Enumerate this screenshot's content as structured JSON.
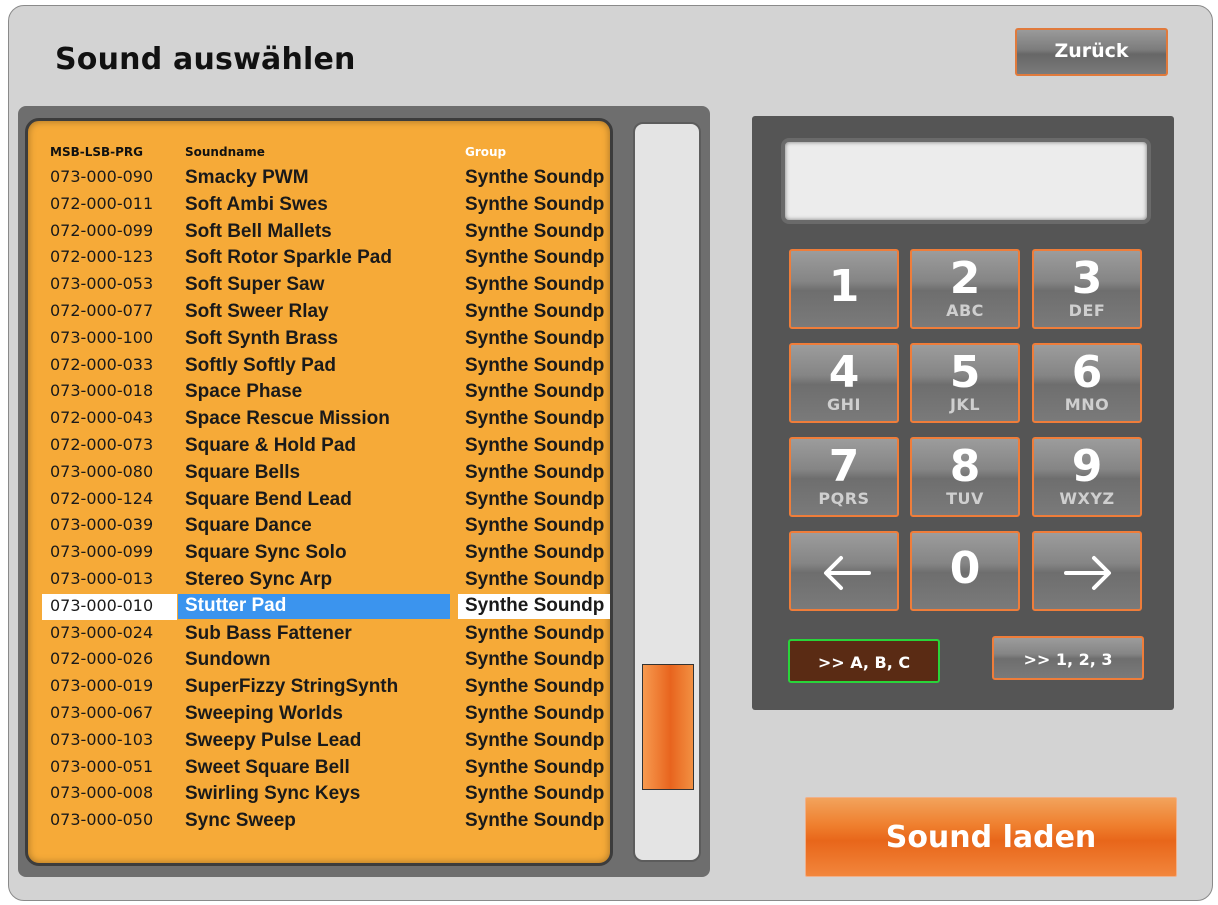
{
  "window": {
    "title": "Sound auswählen",
    "back_label": "Zurück",
    "load_label": "Sound laden"
  },
  "list": {
    "headers": {
      "msb": "MSB-LSB-PRG",
      "name": "Soundname",
      "group": "Group"
    },
    "selected_index": 16,
    "rows": [
      {
        "id": "073-000-090",
        "name": "Smacky PWM",
        "group": "Synthe Soundp"
      },
      {
        "id": "072-000-011",
        "name": "Soft Ambi Swes",
        "group": "Synthe Soundp"
      },
      {
        "id": "072-000-099",
        "name": "Soft Bell Mallets",
        "group": "Synthe Soundp"
      },
      {
        "id": "072-000-123",
        "name": "Soft Rotor Sparkle Pad",
        "group": "Synthe Soundp"
      },
      {
        "id": "073-000-053",
        "name": "Soft Super Saw",
        "group": "Synthe Soundp"
      },
      {
        "id": "072-000-077",
        "name": "Soft Sweer Rlay",
        "group": "Synthe Soundp"
      },
      {
        "id": "073-000-100",
        "name": "Soft Synth Brass",
        "group": "Synthe Soundp"
      },
      {
        "id": "072-000-033",
        "name": "Softly Softly Pad",
        "group": "Synthe Soundp"
      },
      {
        "id": "073-000-018",
        "name": "Space Phase",
        "group": "Synthe Soundp"
      },
      {
        "id": "072-000-043",
        "name": "Space Rescue Mission",
        "group": "Synthe Soundp"
      },
      {
        "id": "072-000-073",
        "name": "Square & Hold Pad",
        "group": "Synthe Soundp"
      },
      {
        "id": "073-000-080",
        "name": "Square Bells",
        "group": "Synthe Soundp"
      },
      {
        "id": "072-000-124",
        "name": "Square Bend Lead",
        "group": "Synthe Soundp"
      },
      {
        "id": "073-000-039",
        "name": "Square Dance",
        "group": "Synthe Soundp"
      },
      {
        "id": "073-000-099",
        "name": "Square Sync Solo",
        "group": "Synthe Soundp"
      },
      {
        "id": "073-000-013",
        "name": "Stereo Sync Arp",
        "group": "Synthe Soundp"
      },
      {
        "id": "073-000-010",
        "name": "Stutter Pad",
        "group": "Synthe Soundp"
      },
      {
        "id": "073-000-024",
        "name": "Sub Bass Fattener",
        "group": "Synthe Soundp"
      },
      {
        "id": "072-000-026",
        "name": "Sundown",
        "group": "Synthe Soundp"
      },
      {
        "id": "073-000-019",
        "name": "SuperFizzy StringSynth",
        "group": "Synthe Soundp"
      },
      {
        "id": "073-000-067",
        "name": "Sweeping Worlds",
        "group": "Synthe Soundp"
      },
      {
        "id": "073-000-103",
        "name": "Sweepy Pulse Lead",
        "group": "Synthe Soundp"
      },
      {
        "id": "073-000-051",
        "name": "Sweet Square Bell",
        "group": "Synthe Soundp"
      },
      {
        "id": "073-000-008",
        "name": "Swirling Sync Keys",
        "group": "Synthe Soundp"
      },
      {
        "id": "073-000-050",
        "name": "Sync Sweep",
        "group": "Synthe Soundp"
      }
    ]
  },
  "keypad": {
    "display_value": "",
    "keys": [
      {
        "num": "1",
        "letters": ""
      },
      {
        "num": "2",
        "letters": "ABC"
      },
      {
        "num": "3",
        "letters": "DEF"
      },
      {
        "num": "4",
        "letters": "GHI"
      },
      {
        "num": "5",
        "letters": "JKL"
      },
      {
        "num": "6",
        "letters": "MNO"
      },
      {
        "num": "7",
        "letters": "PQRS"
      },
      {
        "num": "8",
        "letters": "TUV"
      },
      {
        "num": "9",
        "letters": "WXYZ"
      },
      {
        "num": "0",
        "letters": ""
      }
    ],
    "left_arrow_icon": "arrow-left-icon",
    "right_arrow_icon": "arrow-right-icon",
    "mode_abc_label": ">> A, B, C",
    "mode_123_label": ">> 1, 2, 3",
    "active_mode": "abc"
  },
  "colors": {
    "list_bg": "#f6aa38",
    "selected_name_bg": "#3b94ee",
    "accent_orange": "#ef7d3a",
    "active_mode_border": "#29d43a"
  },
  "scrollbar": {
    "position": 0.78
  }
}
